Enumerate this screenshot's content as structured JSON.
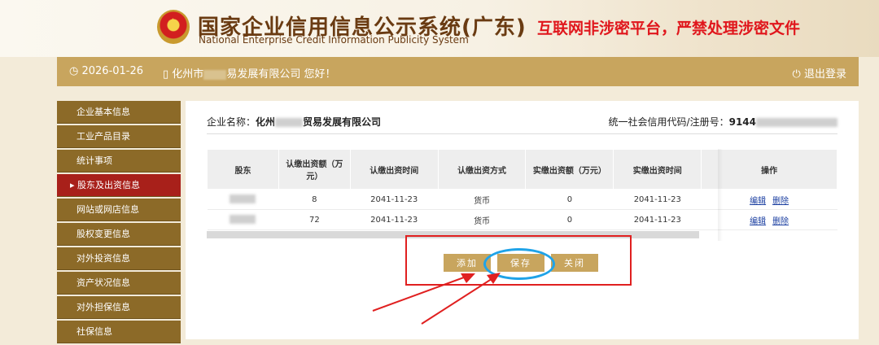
{
  "header": {
    "title_cn": "国家企业信用信息公示系统(广东)",
    "title_en": "National Enterprise Credit Information Publicity System",
    "warning": "互联网非涉密平台，严禁处理涉密文件"
  },
  "topbar": {
    "date": "2026-01-26",
    "greeting_prefix": "化州市",
    "greeting_suffix": "易发展有限公司 您好！",
    "logout": "退出登录"
  },
  "sidebar": {
    "items": [
      {
        "label": "企业基本信息"
      },
      {
        "label": "工业产品目录"
      },
      {
        "label": "统计事项"
      },
      {
        "label": "股东及出资信息",
        "active": true
      },
      {
        "label": "网站或网店信息"
      },
      {
        "label": "股权变更信息"
      },
      {
        "label": "对外投资信息"
      },
      {
        "label": "资产状况信息"
      },
      {
        "label": "对外担保信息"
      },
      {
        "label": "社保信息"
      }
    ]
  },
  "company": {
    "name_label": "企业名称：",
    "name_prefix": "化州",
    "name_suffix": "贸易发展有限公司",
    "credit_label": "统一社会信用代码/注册号：",
    "credit_prefix": "9144"
  },
  "table": {
    "headers": [
      "股东",
      "认缴出资额（万元）",
      "认缴出资时间",
      "认缴出资方式",
      "实缴出资额（万元）",
      "实缴出资时间",
      "操作"
    ],
    "rows": [
      {
        "subscribed": "8",
        "sub_time": "2041-11-23",
        "method": "货币",
        "paid": "0",
        "paid_time": "2041-11-23"
      },
      {
        "subscribed": "72",
        "sub_time": "2041-11-23",
        "method": "货币",
        "paid": "0",
        "paid_time": "2041-11-23"
      }
    ],
    "edit_label": "编辑",
    "delete_label": "删除"
  },
  "actions": {
    "add": "添加",
    "save": "保存",
    "close": "关闭"
  },
  "colors": {
    "gold": "#c8a55e",
    "sidebar": "#8c6a28",
    "active": "#a8201a",
    "warning": "#e0161c",
    "annotation_red": "#e02020",
    "annotation_blue": "#1fa3e8"
  }
}
